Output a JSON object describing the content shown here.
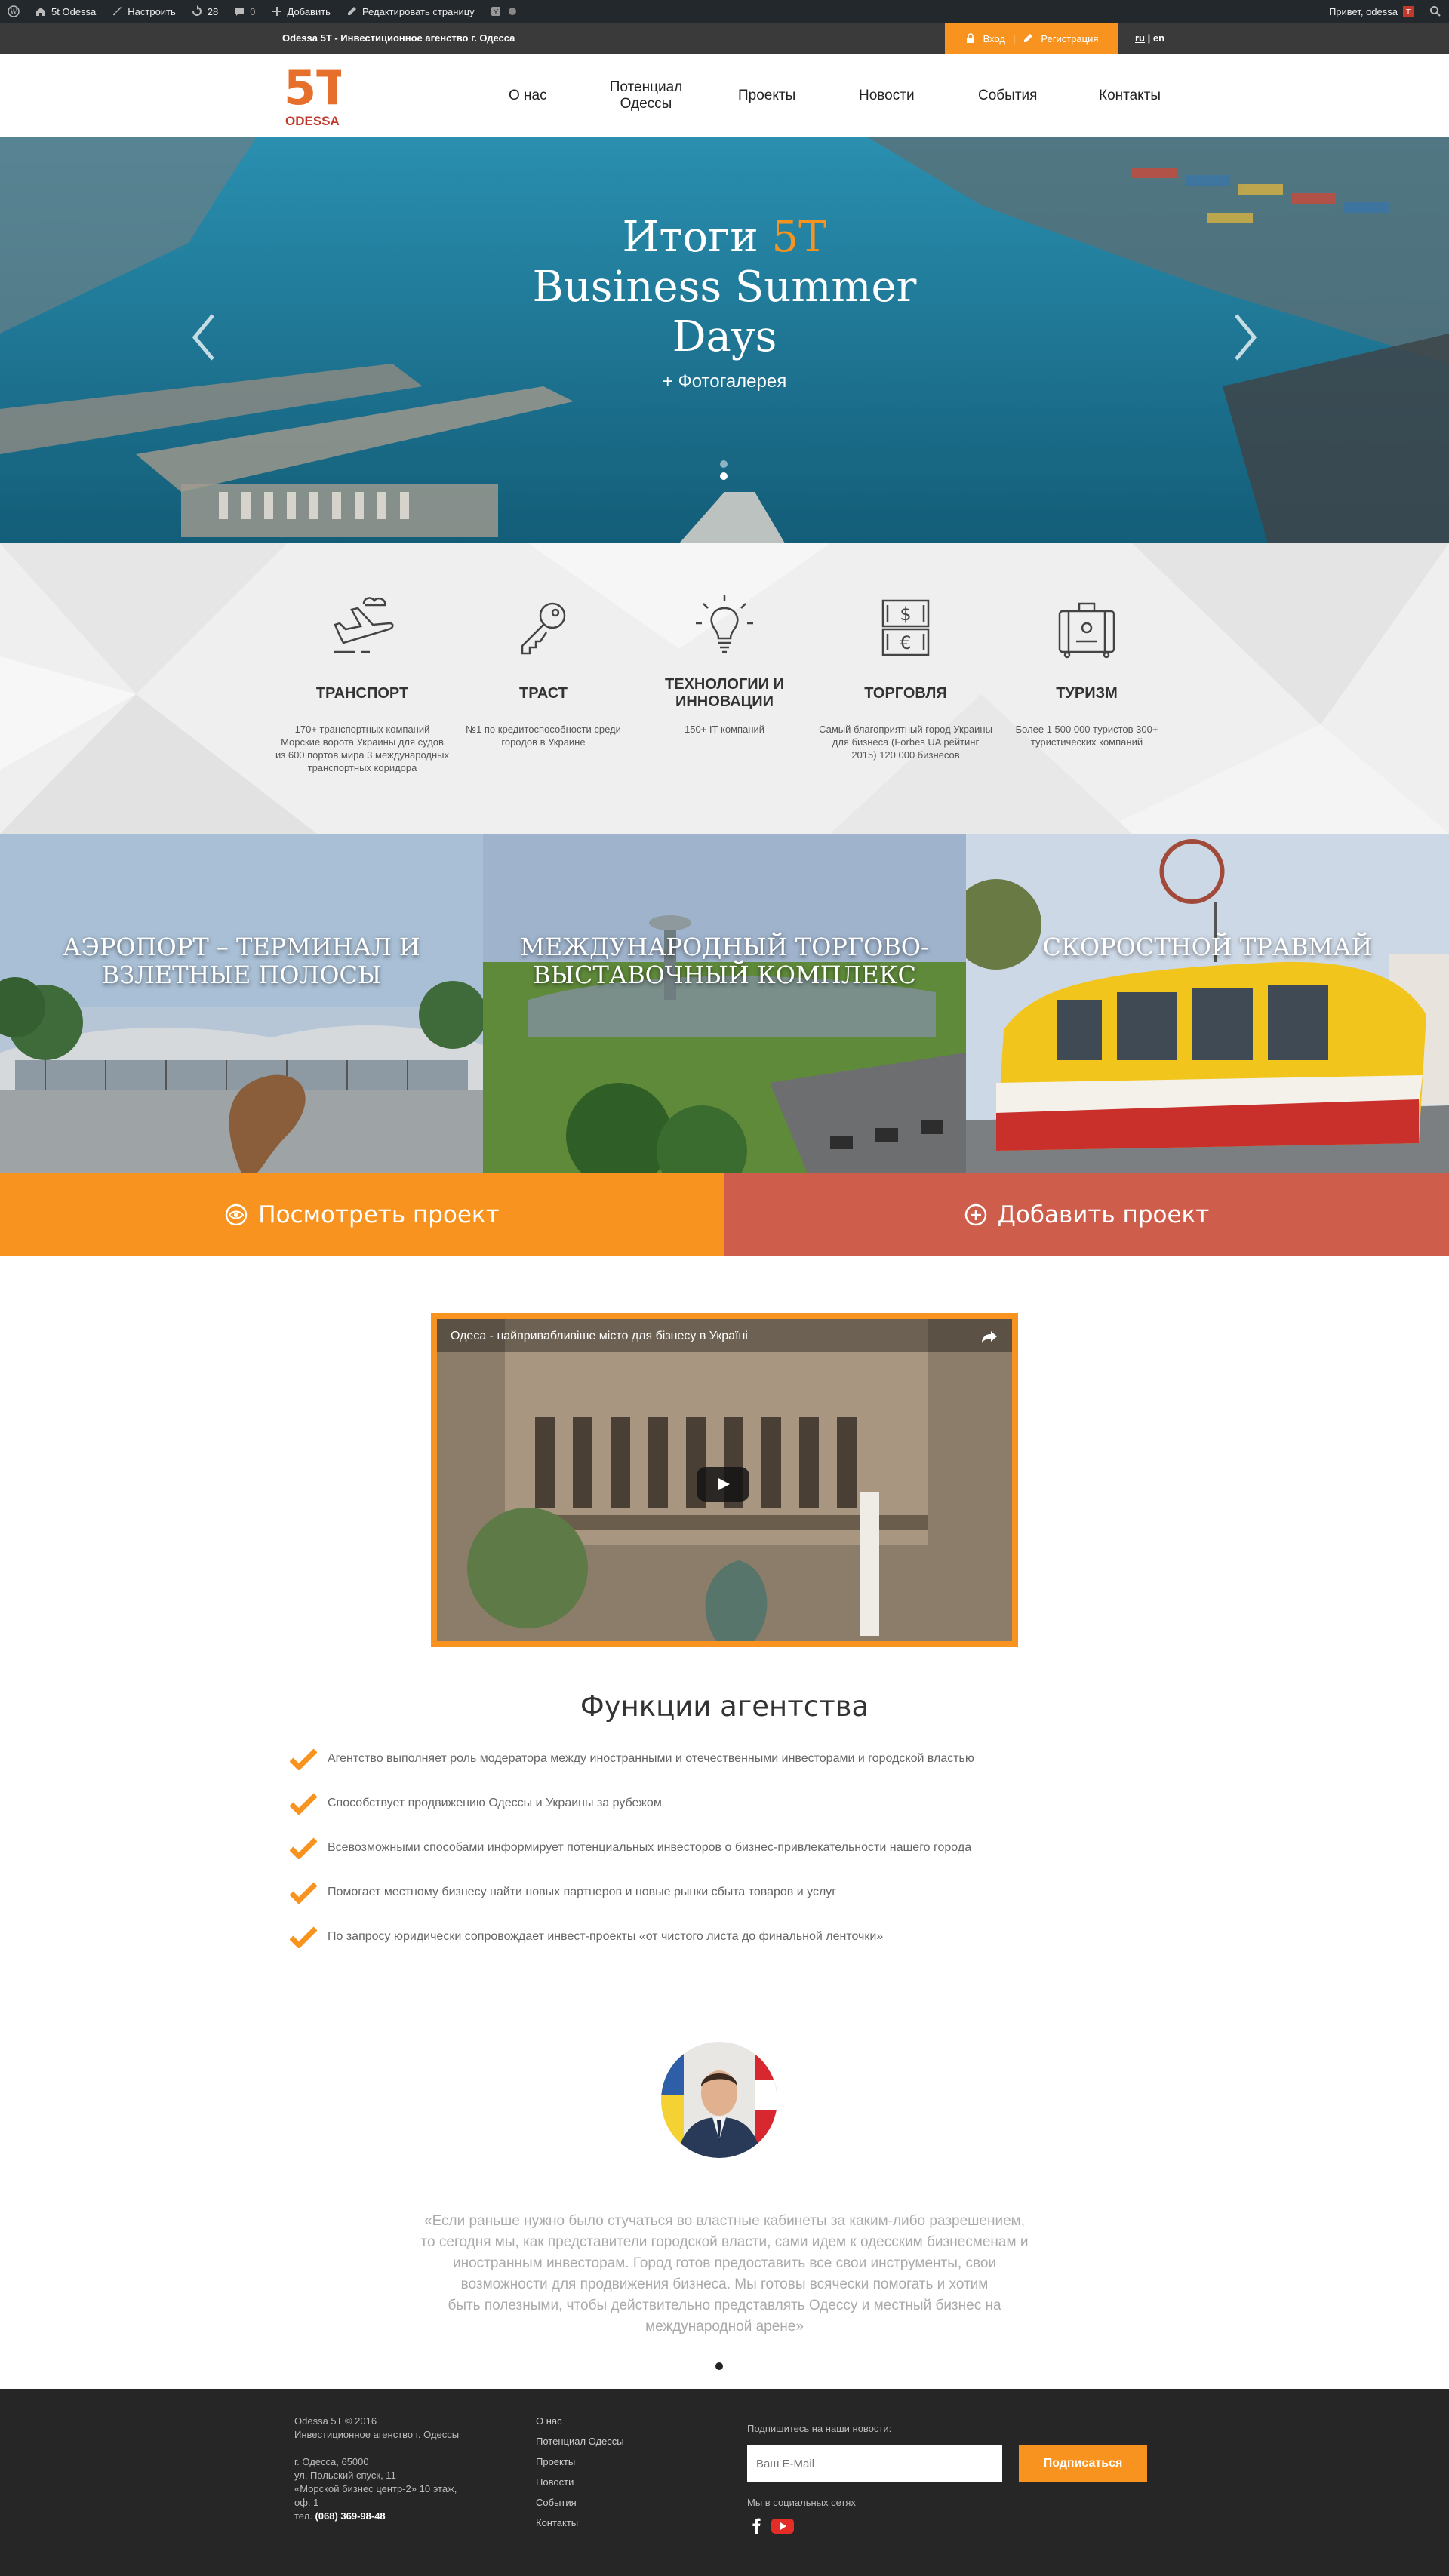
{
  "admin_bar": {
    "site_name": "5t Odessa",
    "customize": "Настроить",
    "updates_count": "28",
    "comments_count": "0",
    "add_new": "Добавить",
    "edit_page": "Редактировать страницу",
    "greeting": "Привет, odessa"
  },
  "top_strip": {
    "site_title": "Odessa 5T - Инвестиционное агенство г. Одесса",
    "login": "Вход",
    "separator": "|",
    "register": "Регистрация",
    "lang_ru": "ru",
    "lang_sep": "|",
    "lang_en": "en"
  },
  "logo": {
    "text": "ODESSA",
    "mark": "5T"
  },
  "nav": [
    {
      "label": "О нас"
    },
    {
      "label": "Потенциал Одессы"
    },
    {
      "label": "Проекты"
    },
    {
      "label": "Новости"
    },
    {
      "label": "События"
    },
    {
      "label": "Контакты"
    }
  ],
  "hero": {
    "title_prefix": "Итоги ",
    "title_accent": "5T",
    "title_line2": "Business Summer",
    "title_line3": "Days",
    "subtitle": "+ Фотогалерея",
    "slide_count": 2,
    "active_slide": 2
  },
  "features": [
    {
      "icon": "airplane-icon",
      "title": "ТРАНСПОРТ",
      "desc": "170+ транспортных компаний Морские ворота Украины для судов из 600 портов мира 3 международных транспортных коридора"
    },
    {
      "icon": "key-icon",
      "title": "ТРАСТ",
      "desc": "№1 по кредитоспособности среди городов в Украине"
    },
    {
      "icon": "lightbulb-icon",
      "title": "ТЕХНОЛОГИИ И ИННОВАЦИИ",
      "desc": "150+ IT-компаний"
    },
    {
      "icon": "currency-icon",
      "title": "ТОРГОВЛЯ",
      "desc": "Самый благоприятный город Украины для бизнеса (Forbes UA рейтинг 2015) 120 000 бизнесов"
    },
    {
      "icon": "suitcase-icon",
      "title": "ТУРИЗМ",
      "desc": "Более 1 500 000 туристов 300+ туристических компаний"
    }
  ],
  "projects": [
    {
      "title": "АЭРОПОРТ – ТЕРМИНАЛ И ВЗЛЕТНЫЕ ПОЛОСЫ"
    },
    {
      "title": "МЕЖДУНАРОДНЫЙ ТОРГОВО-ВЫСТАВОЧНЫЙ КОМПЛЕКС"
    },
    {
      "title": "СКОРОСТНОЙ ТРАВМАЙ"
    }
  ],
  "cta": {
    "view": "Посмотреть проект",
    "add": "Добавить проект"
  },
  "video": {
    "title": "Одеса - найпривабливіше місто для бізнесу в Україні"
  },
  "functions": {
    "title": "Функции агентства",
    "items": [
      "Агентство выполняет роль модератора между иностранными и отечественными инвесторами и городской властью",
      "Способствует продвижению Одессы и Украины за рубежом",
      "Всевозможными способами информирует потенциальных инвесторов о бизнес-привлекательности нашего города",
      "Помогает местному бизнесу найти новых партнеров и новые рынки сбыта товаров и услуг",
      "По запросу юридически сопровождает инвест-проекты «от чистого листа до финальной ленточки»"
    ]
  },
  "quote": {
    "lines": [
      "«Если раньше нужно было стучаться во властные кабинеты за каким-либо разрешением,",
      "то сегодня мы, как представители городской власти, сами идем к одесским бизнесменам и",
      "иностранным инвесторам. Город готов предоставить все свои инструменты, свои",
      "возможности для продвижения бизнеса. Мы готовы всячески помогать и хотим",
      "быть полезными, чтобы действительно представлять Одессу и местный бизнес на",
      "международной арене»"
    ]
  },
  "footer": {
    "copyright": "Odessa 5T © 2016",
    "agency": "Инвестиционное агенство г. Одессы",
    "address_lines": [
      "г. Одесса, 65000",
      "ул. Польский спуск, 11",
      "«Морской бизнес центр-2» 10 этаж,",
      "оф. 1"
    ],
    "phone_label": "тел.",
    "phone": "(068) 369-98-48",
    "links": [
      "О нас",
      "Потенциал Одессы",
      "Проекты",
      "Новости",
      "События",
      "Контакты"
    ],
    "subscribe_label": "Подпишитесь на наши новости:",
    "email_placeholder": "Ваш E-Mail",
    "subscribe_button": "Подписаться",
    "social_label": "Мы в социальных сетях"
  },
  "colors": {
    "accent": "#f7931e",
    "cta_add": "#cf5d4b",
    "footer_bg": "#262626",
    "admin_bg": "#23282d"
  }
}
